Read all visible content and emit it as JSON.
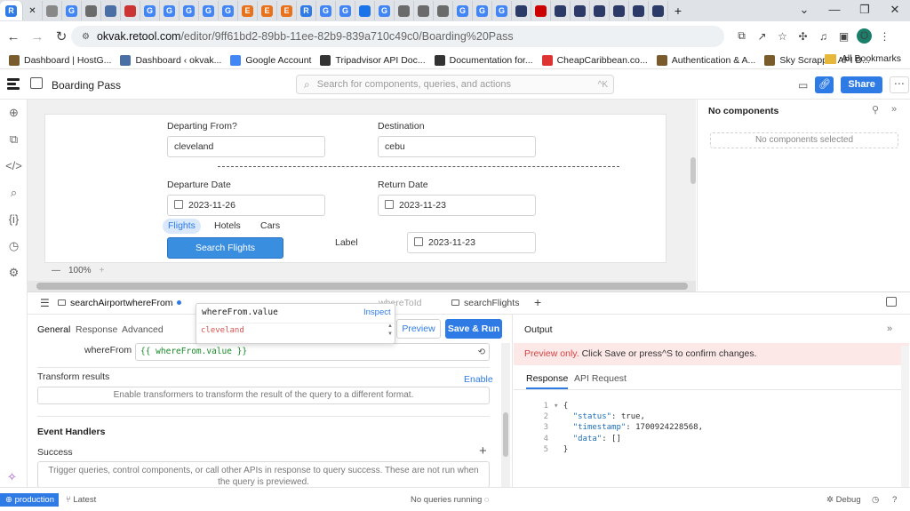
{
  "browser": {
    "url_host": "okvak.retool.com",
    "url_path": "/editor/9ff61bd2-89bb-11ee-82b9-839a710c49c0/Boarding%20Pass",
    "profile_initial": "O",
    "tab_glyphs": [
      "R",
      "",
      "G",
      "",
      "",
      "",
      "G",
      "G",
      "G",
      "G",
      "G",
      "E",
      "E",
      "E",
      "R",
      "G",
      "G",
      "",
      "G",
      "",
      "",
      "",
      "G",
      "G",
      "G",
      "",
      "",
      "",
      "",
      "",
      "",
      "",
      ""
    ],
    "bookmarks": [
      "Dashboard | HostG...",
      "Dashboard ‹ okvak...",
      "Google Account",
      "Tripadvisor API Doc...",
      "Documentation for...",
      "CheapCaribbean.co...",
      "Authentication & A...",
      "Sky Scrapper API D..."
    ],
    "all_bookmarks": "All Bookmarks"
  },
  "header": {
    "app_title": "Boarding Pass",
    "search_placeholder": "Search for components, queries, and actions",
    "search_shortcut": "^K",
    "share_label": "Share"
  },
  "canvas": {
    "departing_label": "Departing From?",
    "departing_value": "cleveland",
    "destination_label": "Destination",
    "destination_value": "cebu",
    "departure_date_label": "Departure Date",
    "departure_date_value": "2023-11-26",
    "return_date_label": "Return Date",
    "return_date_value": "2023-11-23",
    "tabs": [
      "Flights",
      "Hotels",
      "Cars"
    ],
    "search_button": "Search Flights",
    "label_text": "Label",
    "label_date_value": "2023-11-23",
    "zoom": "100%"
  },
  "inspector": {
    "title": "No components",
    "empty": "No components selected"
  },
  "query_panel": {
    "tabs": [
      "searchAirportwhereFrom",
      "...heretoId",
      "...",
      "whereToId",
      "searchFlights"
    ],
    "active_tab": "searchAirportwhereFrom",
    "subtabs": [
      "General",
      "Response",
      "Advanced"
    ],
    "preview": "Preview",
    "save_run": "Save & Run",
    "param_label": "whereFrom",
    "param_value": "{{ whereFrom.value }}",
    "transform_label": "Transform results",
    "transform_enable": "Enable",
    "transform_hint": "Enable transformers to transform the result of the query to a different format.",
    "event_handlers": "Event Handlers",
    "success": "Success",
    "success_hint": "Trigger queries, control components, or call other APIs in response to query success. These are not run when the query is previewed."
  },
  "autocomplete": {
    "expression": "whereFrom.value",
    "inspect": "Inspect",
    "result": "cleveland"
  },
  "output": {
    "title": "Output",
    "preview_note_prefix": "Preview only.",
    "preview_note_rest": " Click Save or press^S to confirm changes.",
    "tabs": [
      "Response",
      "API Request"
    ],
    "json_lines": [
      {
        "n": "1",
        "text": "{"
      },
      {
        "n": "2",
        "key": "\"status\"",
        "val": ": true,"
      },
      {
        "n": "3",
        "key": "\"timestamp\"",
        "val": ": 1700924228568,"
      },
      {
        "n": "4",
        "key": "\"data\"",
        "val": ": []"
      },
      {
        "n": "5",
        "text": "}"
      }
    ]
  },
  "status": {
    "env": "production",
    "version": "Latest",
    "queries": "No queries running",
    "debug": "Debug"
  },
  "colors": {
    "accent": "#2f7be5",
    "error": "#d9534f",
    "warning_bg": "#fde8e8"
  }
}
